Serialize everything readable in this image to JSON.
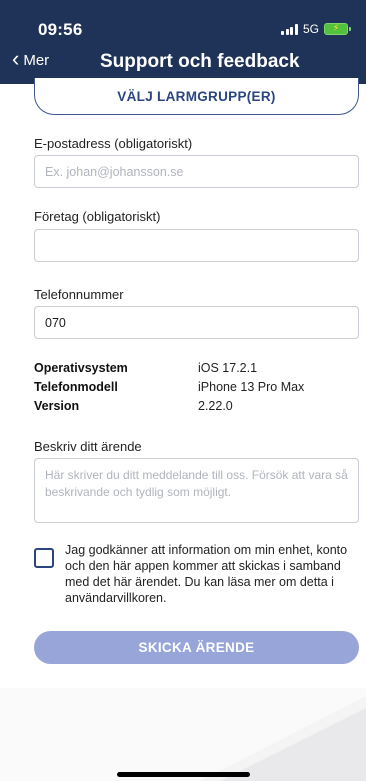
{
  "status": {
    "time": "09:56",
    "network": "5G"
  },
  "nav": {
    "back_label": "Mer",
    "title": "Support och feedback"
  },
  "alarm_group_button": "VÄLJ LARMGRUPP(ER)",
  "email": {
    "label": "E-postadress (obligatoriskt)",
    "placeholder": "Ex. johan@johansson.se"
  },
  "company": {
    "label": "Företag (obligatoriskt)",
    "value": ""
  },
  "phone": {
    "label": "Telefonnummer",
    "value": "070"
  },
  "device_info": [
    {
      "key": "Operativsystem",
      "value": "iOS 17.2.1"
    },
    {
      "key": "Telefonmodell",
      "value": "iPhone 13 Pro Max"
    },
    {
      "key": "Version",
      "value": "2.22.0"
    }
  ],
  "description": {
    "label": "Beskriv ditt ärende",
    "placeholder": "Här skriver du ditt meddelande till oss. Försök att vara så beskrivande och tydlig som möjligt."
  },
  "consent_text": "Jag godkänner att information om min enhet, konto och den här appen kommer att skickas i samband med det här ärendet. Du kan läsa mer om detta i användarvillkoren.",
  "consent_checked": false,
  "submit_label": "SKICKA ÄRENDE",
  "colors": {
    "header": "#1f3257",
    "accent": "#2b4580",
    "submit_disabled": "#97a5d9"
  }
}
